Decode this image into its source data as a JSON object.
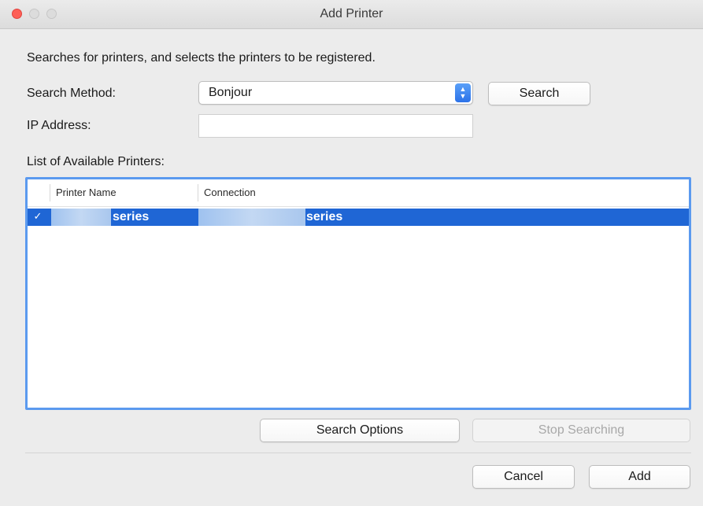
{
  "window": {
    "title": "Add Printer"
  },
  "description": "Searches for printers, and selects the printers to be registered.",
  "search_method": {
    "label": "Search Method:",
    "value": "Bonjour"
  },
  "search_button": "Search",
  "ip_address": {
    "label": "IP Address:",
    "value": "",
    "placeholder": ""
  },
  "printer_list": {
    "label": "List of Available Printers:",
    "columns": [
      "Printer Name",
      "Connection"
    ],
    "rows": [
      {
        "checked": true,
        "selected": true,
        "printer_name": "series",
        "connection": "series"
      }
    ]
  },
  "search_options_button": "Search Options",
  "stop_searching_button": "Stop Searching",
  "cancel_button": "Cancel",
  "add_button": "Add",
  "colors": {
    "accent": "#1f66d5",
    "focus_ring": "#5b9aef",
    "close": "#fd5f57"
  }
}
